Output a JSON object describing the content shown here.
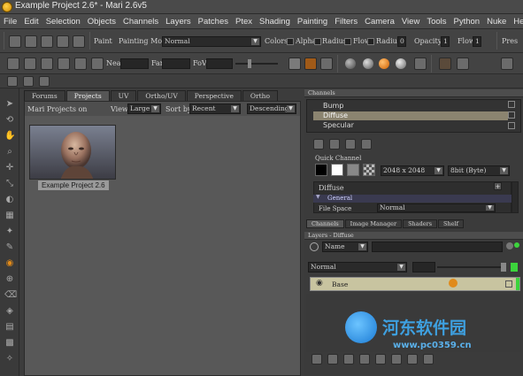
{
  "window": {
    "title": "Example Project 2.6* - Mari 2.6v5"
  },
  "menu": [
    "File",
    "Edit",
    "Selection",
    "Objects",
    "Channels",
    "Layers",
    "Patches",
    "Ptex",
    "Shading",
    "Painting",
    "Filters",
    "Camera",
    "View",
    "Tools",
    "Python",
    "Nuke",
    "Help"
  ],
  "toolbar1": {
    "paint_label": "Paint",
    "painting_mode_label": "Painting Mode",
    "painting_mode_value": "Normal",
    "colors_label": "Colors",
    "alpha_label": "Alpha",
    "radius_label": "Radius",
    "flow_label": "Flow",
    "radius2_label": "Radius",
    "radius2_value": "0",
    "opacity_label": "Opacity",
    "opacity_value": "1",
    "flow2_label": "Flow",
    "flow2_value": "1",
    "pres_label": "Pres"
  },
  "toolbar2": {
    "near_label": "Near",
    "far_label": "Far",
    "fov_label": "FoV"
  },
  "center": {
    "tabs": [
      "Forums",
      "Projects",
      "UV",
      "Ortho/UV",
      "Perspective",
      "Ortho"
    ],
    "active_tab": "Projects",
    "header_label": "Mari Projects on",
    "view_label": "View",
    "view_value": "Large",
    "sort_label": "Sort by",
    "sort_value": "Recent",
    "order_value": "Descending",
    "project_name": "Example Project 2.6"
  },
  "channels": {
    "title": "Channels",
    "items": [
      "Bump",
      "Diffuse",
      "Specular"
    ],
    "selected": "Diffuse",
    "quick_channel_label": "Quick Channel",
    "size_value": "2048 x 2048",
    "depth_value": "8bit (Byte)",
    "channel_name": "Diffuse",
    "general_label": "General",
    "file_space_label": "File Space",
    "file_space_value": "Normal"
  },
  "right_tabs": [
    "Channels",
    "Image Manager",
    "Shaders",
    "Shelf"
  ],
  "layers": {
    "title": "Layers - Diffuse",
    "filter_value": "Name",
    "blend_value": "Normal",
    "layer_name": "Base"
  },
  "watermark": {
    "name": "河东软件园",
    "url": "www.pc0359.cn"
  },
  "colors": {
    "accent": "#e08a1a",
    "selection": "#8b8470",
    "layer_tint": "#c8c4a0",
    "green": "#3cd43c"
  }
}
